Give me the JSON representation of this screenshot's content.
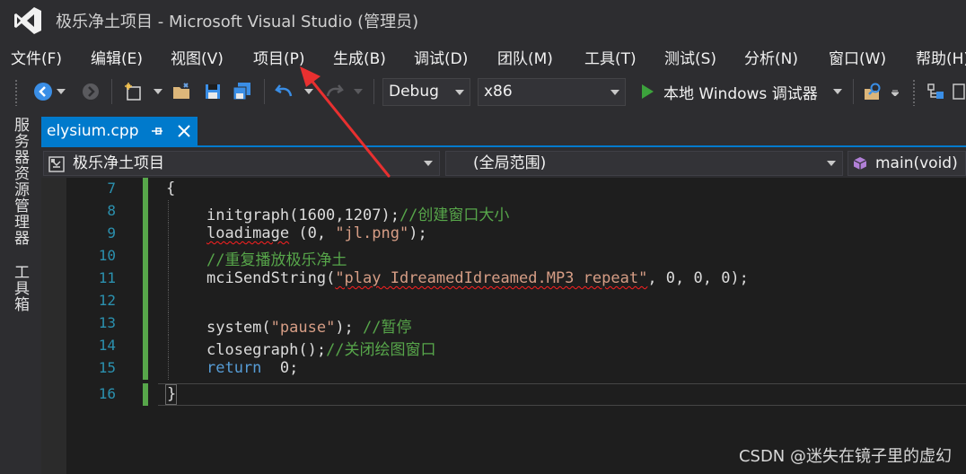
{
  "window": {
    "title": "极乐净土项目 - Microsoft Visual Studio (管理员)",
    "logo_icon": "visual-studio-logo"
  },
  "menu": {
    "items": [
      "文件(F)",
      "编辑(E)",
      "视图(V)",
      "项目(P)",
      "生成(B)",
      "调试(D)",
      "团队(M)",
      "工具(T)",
      "测试(S)",
      "分析(N)",
      "窗口(W)",
      "帮助(H)"
    ]
  },
  "toolbar": {
    "config": "Debug",
    "platform": "x86",
    "run_label": "本地 Windows 调试器"
  },
  "sidebar": {
    "tabs": [
      "服务器资源管理器",
      "工具箱"
    ]
  },
  "editor_tab": {
    "filename": "elysium.cpp",
    "pin_icon": "pin-icon",
    "close_icon": "close-icon"
  },
  "navbar": {
    "project": "极乐净土项目",
    "scope": "(全局范围)",
    "member": "main(void)"
  },
  "code": {
    "line_numbers": [
      "7",
      "8",
      "9",
      "10",
      "11",
      "12",
      "13",
      "14",
      "15",
      "16"
    ],
    "l7": "{",
    "l8_fn": "initgraph(1600,1207);",
    "l8_com": "//创建窗口大小",
    "l9_fn": "loadimage",
    "l9_args": " (0, ",
    "l9_str": "\"jl.png\"",
    "l9_end": ");",
    "l10_com": "//重复播放极乐净土",
    "l11_fn": "mciSendString",
    "l11_open": "(",
    "l11_str": "\"play IdreamedIdreamed.MP3 repeat\"",
    "l11_end": ", 0, 0, 0);",
    "l13_fn": "system(",
    "l13_str": "\"pause\"",
    "l13_end": "); ",
    "l13_com": "//暂停",
    "l14_fn": "closegraph();",
    "l14_com": "//关闭绘图窗口",
    "l15_kw": "return",
    "l15_rest": "  0;",
    "l16": "}"
  },
  "watermark": "CSDN @迷失在镜子里的虚幻",
  "colors": {
    "accent": "#007acc",
    "annotation_arrow": "#e83030"
  }
}
